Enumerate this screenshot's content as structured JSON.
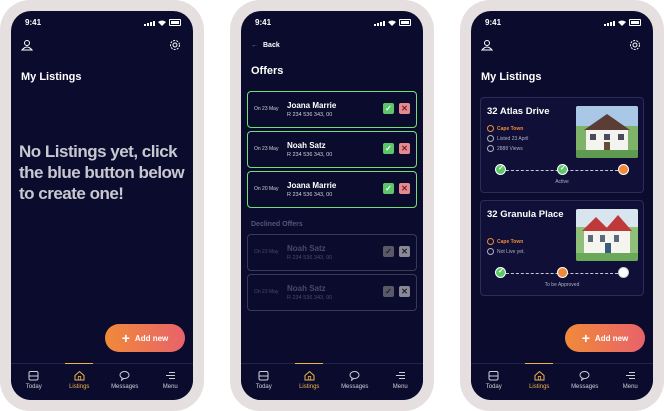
{
  "status": {
    "time": "9:41"
  },
  "tabs": [
    {
      "label": "Today",
      "icon": "calendar-icon"
    },
    {
      "label": "Listings",
      "icon": "home-icon"
    },
    {
      "label": "Messages",
      "icon": "chat-icon"
    },
    {
      "label": "Menu",
      "icon": "menu-icon"
    }
  ],
  "screen1": {
    "title": "My Listings",
    "empty_message": "No Listings yet, click the blue button below to create one!",
    "add_button": "Add new"
  },
  "screen2": {
    "back": "Back",
    "title": "Offers",
    "offers": [
      {
        "date": "On 23 May",
        "name": "Joana Marrie",
        "amount": "R 234 536 343, 00"
      },
      {
        "date": "On 23 May",
        "name": "Noah Satz",
        "amount": "R 234 536 343, 00"
      },
      {
        "date": "On 20 May",
        "name": "Joana Marrie",
        "amount": "R 234 536 343, 00"
      }
    ],
    "declined_label": "Declined Offers",
    "declined": [
      {
        "date": "On 23 May",
        "name": "Noah Satz",
        "amount": "R 234 536 343, 00"
      },
      {
        "date": "On 23 May",
        "name": "Noah Satz",
        "amount": "R 234 536 343, 00"
      }
    ]
  },
  "screen3": {
    "title": "My Listings",
    "add_button": "Add new",
    "listings": [
      {
        "title": "32 Atlas Drive",
        "location": "Cape Town",
        "listed": "Listed 23 April",
        "views": "2888 Views",
        "stage": "Active",
        "progress_step": 2
      },
      {
        "title": "32 Granula Place",
        "location": "Cape Town",
        "listed": "Not Live yet.",
        "stage": "To be Approved",
        "progress_step": 2
      }
    ]
  },
  "colors": {
    "background": "#0b0b2e",
    "accent": "#f08a3a",
    "success": "#5cc76a",
    "active_tab": "#f0b44a"
  }
}
